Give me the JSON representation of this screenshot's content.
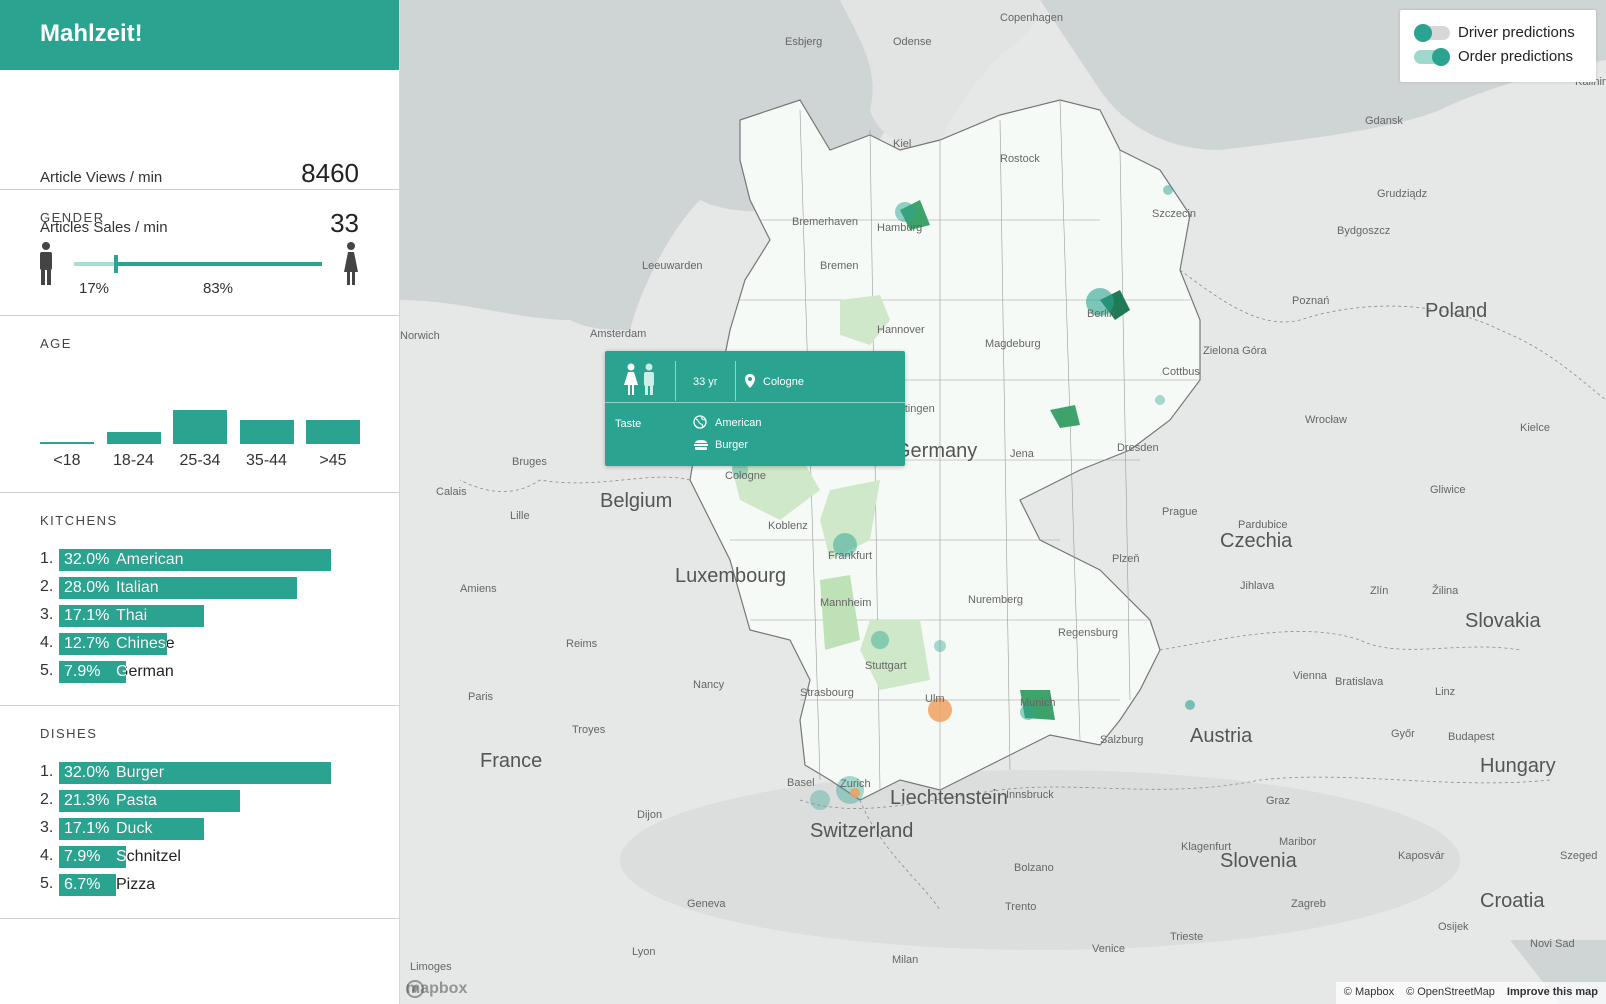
{
  "sidebar": {
    "brand": "Mahlzeit!",
    "stats": [
      {
        "label": "Article Views / min",
        "value": "8460"
      },
      {
        "label": "Articles Sales / min",
        "value": "33"
      }
    ],
    "gender": {
      "title": "GENDER",
      "male_pct_label": "17%",
      "female_pct_label": "83%",
      "male_share": 0.17,
      "female_share": 0.83
    },
    "age": {
      "title": "AGE",
      "groups": [
        {
          "label": "<18",
          "share": 0.03
        },
        {
          "label": "18-24",
          "share": 0.35
        },
        {
          "label": "25-34",
          "share": 1.0
        },
        {
          "label": "35-44",
          "share": 0.72
        },
        {
          "label": ">45",
          "share": 0.72
        }
      ]
    },
    "kitchens": {
      "title": "KITCHENS",
      "items": [
        {
          "rank": "1.",
          "pct": "32.0%",
          "label": "American",
          "share": 0.32
        },
        {
          "rank": "2.",
          "pct": "28.0%",
          "label": "Italian",
          "share": 0.28
        },
        {
          "rank": "3.",
          "pct": "17.1%",
          "label": "Thai",
          "share": 0.171
        },
        {
          "rank": "4.",
          "pct": "12.7%",
          "label": "Chinese",
          "share": 0.127
        },
        {
          "rank": "5.",
          "pct": "7.9%",
          "label": "German",
          "share": 0.079
        }
      ]
    },
    "dishes": {
      "title": "DISHES",
      "items": [
        {
          "rank": "1.",
          "pct": "32.0%",
          "label": "Burger",
          "share": 0.32
        },
        {
          "rank": "2.",
          "pct": "21.3%",
          "label": "Pasta",
          "share": 0.213
        },
        {
          "rank": "3.",
          "pct": "17.1%",
          "label": "Duck",
          "share": 0.171
        },
        {
          "rank": "4.",
          "pct": "7.9%",
          "label": "Schnitzel",
          "share": 0.079
        },
        {
          "rank": "5.",
          "pct": "6.7%",
          "label": "Pizza",
          "share": 0.067
        }
      ]
    }
  },
  "map": {
    "toggles": [
      {
        "label": "Driver predictions",
        "on": false
      },
      {
        "label": "Order predictions",
        "on": true
      }
    ],
    "popup": {
      "age": "33 yr",
      "city": "Cologne",
      "taste_label": "Taste",
      "kitchen": "American",
      "dish": "Burger"
    },
    "countries": [
      "Germany",
      "Poland",
      "Belgium",
      "Luxembourg",
      "France",
      "Czechia",
      "Slovakia",
      "Austria",
      "Hungary",
      "Switzerland",
      "Liechtenstein",
      "Slovenia",
      "Croatia"
    ],
    "cities": [
      "Copenhagen",
      "Esbjerg",
      "Odense",
      "Gdansk",
      "Kaliningrad",
      "Grudziądz",
      "Bydgoszcz",
      "Kiel",
      "Rostock",
      "Szczecin",
      "Hamburg",
      "Bremerhaven",
      "Bremen",
      "Leeuwarden",
      "Amsterdam",
      "Norwich",
      "Hannover",
      "Magdeburg",
      "Berlin",
      "Poznań",
      "Zielona Góra",
      "Cottbus",
      "Göttingen",
      "Jena",
      "Dresden",
      "Wrocław",
      "Kielce",
      "Bruges",
      "Calais",
      "Lille",
      "Cologne",
      "Koblenz",
      "Frankfurt",
      "Prague",
      "Pardubice",
      "Gliwice",
      "Plzeň",
      "Jihlava",
      "Zlín",
      "Žilina",
      "Amiens",
      "Mannheim",
      "Nuremberg",
      "Reims",
      "Regensburg",
      "Stuttgart",
      "Nancy",
      "Strasbourg",
      "Ulm",
      "Munich",
      "Linz",
      "Vienna",
      "Bratislava",
      "Paris",
      "Troyes",
      "Salzburg",
      "Győr",
      "Budapest",
      "Basel",
      "Zurich",
      "Innsbruck",
      "Graz",
      "Dijon",
      "Klagenfurt",
      "Maribor",
      "Kaposvár",
      "Bolzano",
      "Trento",
      "Zagreb",
      "Osijek",
      "Geneva",
      "Lyon",
      "Trieste",
      "Milan",
      "Venice",
      "Novi Sad",
      "Limoges",
      "Szeged"
    ],
    "attribution": [
      "© Mapbox",
      "© OpenStreetMap",
      "Improve this map"
    ],
    "logo": "mapbox"
  },
  "colors": {
    "accent": "#2ba391",
    "accent_light": "#a8ddd3",
    "region_fill": "#f6faf6",
    "hotspot_orange": "#f0a060"
  }
}
